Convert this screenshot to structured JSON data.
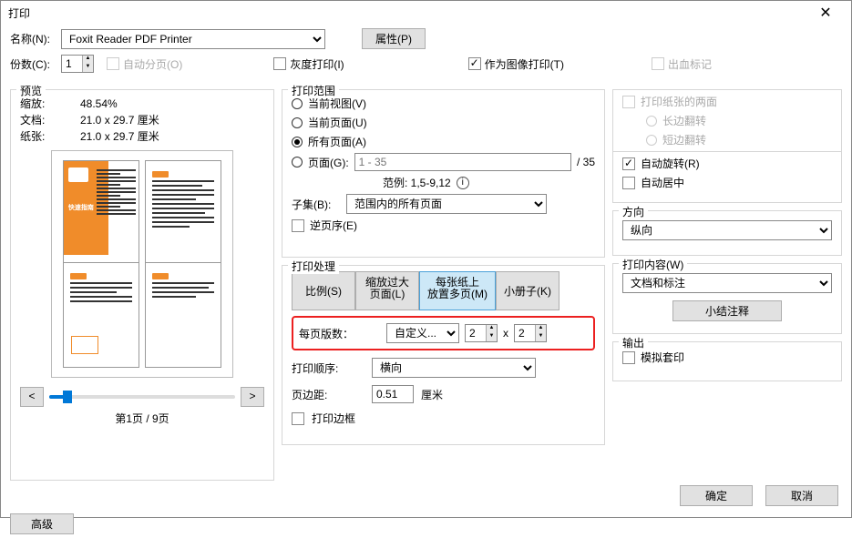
{
  "title": "打印",
  "close_glyph": "✕",
  "top": {
    "name_label": "名称(N):",
    "printer": "Foxit Reader PDF Printer",
    "properties_btn": "属性(P)",
    "copies_label": "份数(C):",
    "copies": "1",
    "collate": "自动分页(O)",
    "grayscale": "灰度打印(I)",
    "as_image": "作为图像打印(T)",
    "bleed": "出血标记"
  },
  "preview": {
    "title": "预览",
    "zoom_label": "缩放:",
    "zoom": "48.54%",
    "doc_label": "文档:",
    "doc_size": "21.0 x 29.7 厘米",
    "paper_label": "纸张:",
    "paper_size": "21.0 x 29.7 厘米",
    "thumb_title": "快速指南",
    "prev": "<",
    "next": ">",
    "page_of": "第1页 / 9页"
  },
  "range": {
    "title": "打印范围",
    "current_view": "当前视图(V)",
    "current_page": "当前页面(U)",
    "all_pages": "所有页面(A)",
    "pages_label": "页面(G):",
    "pages_placeholder": "1 - 35",
    "total": "/ 35",
    "example": "范例: 1,5-9,12",
    "subset_label": "子集(B):",
    "subset_value": "范围内的所有页面",
    "reverse": "逆页序(E)"
  },
  "handling": {
    "title": "打印处理",
    "tab_scale": "比例(S)",
    "tab_fit1": "缩放过大",
    "tab_fit2": "页面(L)",
    "tab_multi1": "每张纸上",
    "tab_multi2": "放置多页(M)",
    "tab_booklet": "小册子(K)",
    "per_sheet_label": "每页版数：",
    "per_sheet_custom": "自定义...",
    "col_val": "2",
    "times": "x",
    "row_val": "2",
    "order_label": "打印顺序:",
    "order_value": "横向",
    "margin_label": "页边距:",
    "margin_value": "0.51",
    "margin_unit": "厘米",
    "print_border": "打印边框"
  },
  "duplex": {
    "both": "打印纸张的两面",
    "long": "长边翻转",
    "short": "短边翻转",
    "auto_rotate": "自动旋转(R)",
    "auto_center": "自动居中"
  },
  "orientation": {
    "title": "方向",
    "value": "纵向"
  },
  "what": {
    "title": "打印内容(W)",
    "value": "文档和标注",
    "summary_btn": "小结注释"
  },
  "output": {
    "title": "输出",
    "simulate": "模拟套印"
  },
  "advanced_btn": "高级",
  "ok_btn": "确定",
  "cancel_btn": "取消"
}
